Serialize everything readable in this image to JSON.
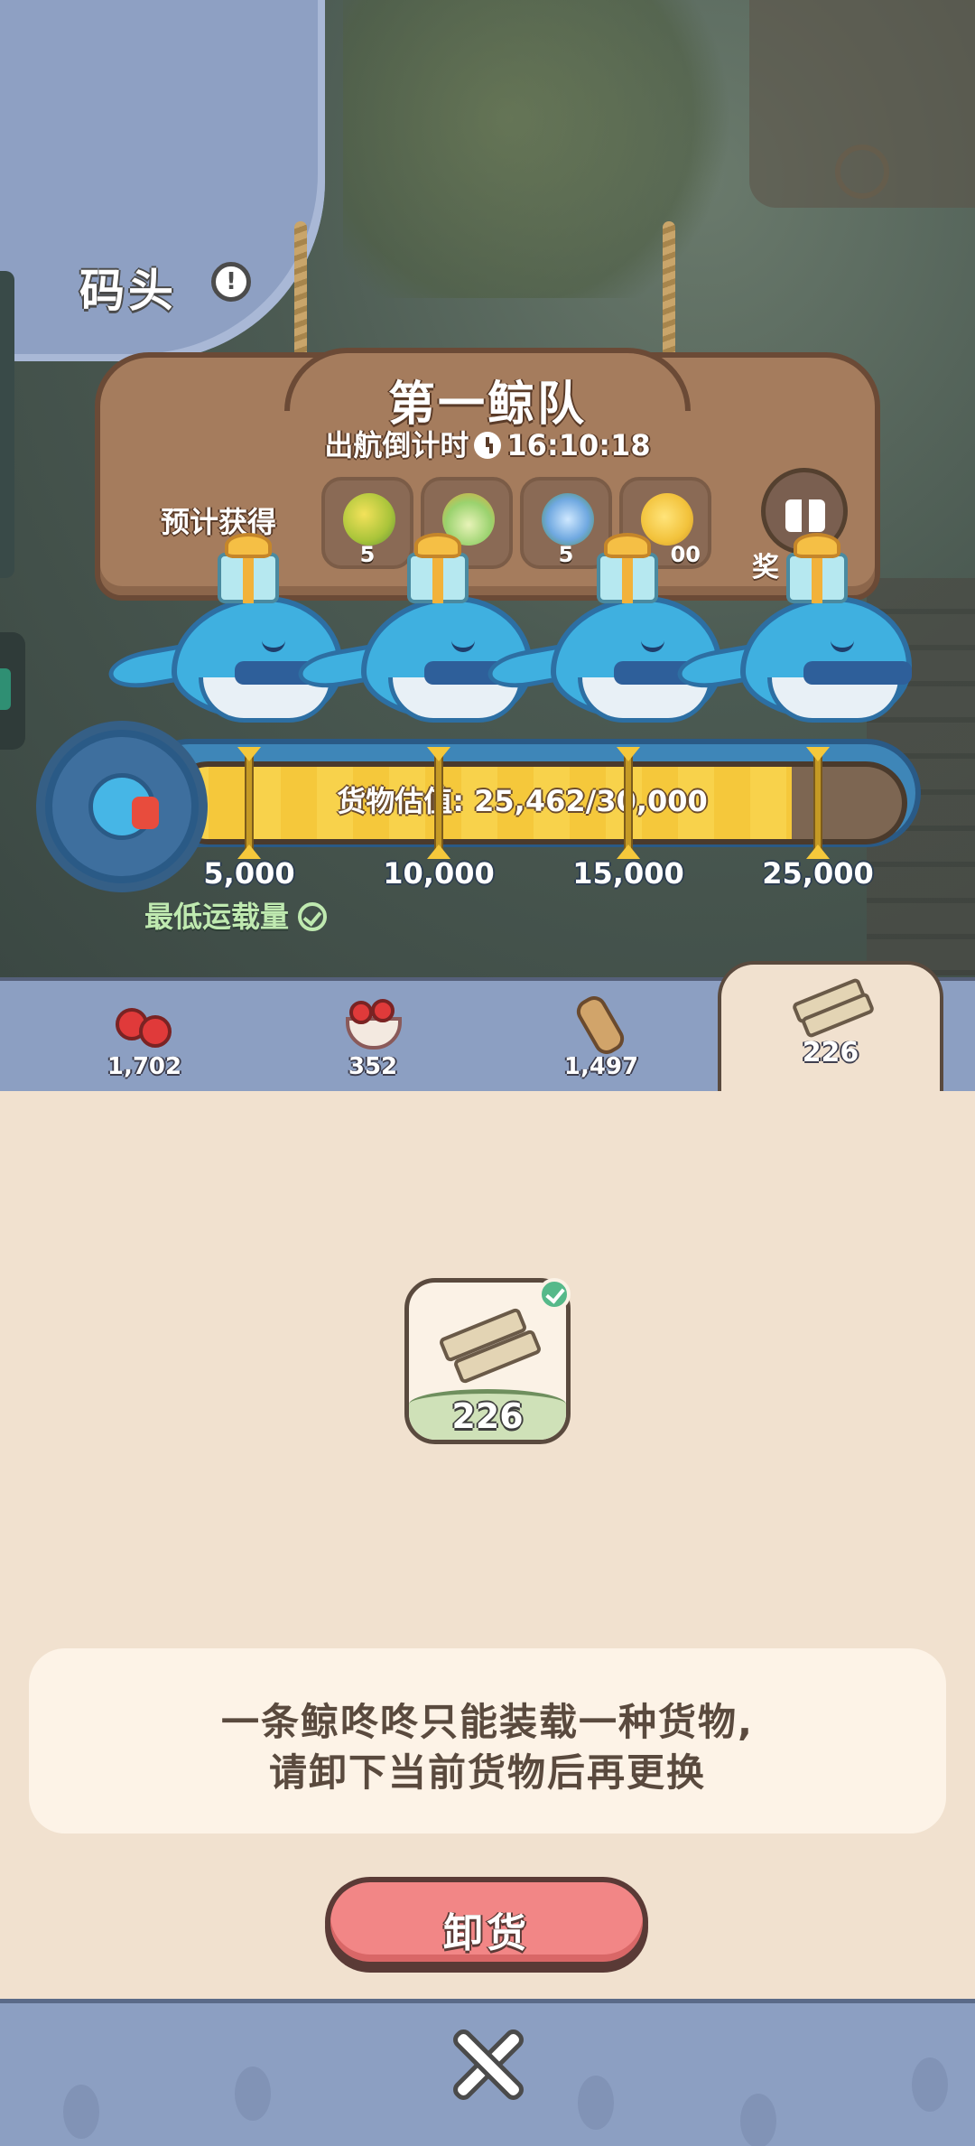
{
  "location": {
    "title": "码头"
  },
  "fleet": {
    "title": "第一鲸队",
    "countdown_label": "出航倒计时",
    "countdown_time": "16:10:18",
    "expected_label": "预计获得",
    "rewards": [
      {
        "icon": "lemon-leaf-icon",
        "qty": "5"
      },
      {
        "icon": "potion-bottle-icon",
        "qty": ""
      },
      {
        "icon": "blue-flower-icon",
        "qty": "5"
      },
      {
        "icon": "gold-coin-icon",
        "qty": "00"
      }
    ],
    "reward_button_label": "奖"
  },
  "cargo": {
    "label": "货物估值: 25,462/30,000",
    "current": 25462,
    "max": 30000,
    "milestones": [
      "5,000",
      "10,000",
      "15,000",
      "25,000"
    ],
    "min_load_label": "最低运载量"
  },
  "tabs": [
    {
      "icon": "apple-icon",
      "count": "1,702"
    },
    {
      "icon": "berry-bowl-icon",
      "count": "352"
    },
    {
      "icon": "log-icon",
      "count": "1,497"
    },
    {
      "icon": "plank-icon",
      "count": "226",
      "active": true
    }
  ],
  "loaded_item": {
    "icon": "plank-icon",
    "qty": "226"
  },
  "notice": {
    "line1": "一条鲸咚咚只能装载一种货物,",
    "line2": "请卸下当前货物后再更换"
  },
  "unload_button": "卸货",
  "colors": {
    "accent": "#f28686",
    "panel": "#f1e1cf",
    "tabbar": "#8c9fc2",
    "progress": "#f8d24b"
  }
}
